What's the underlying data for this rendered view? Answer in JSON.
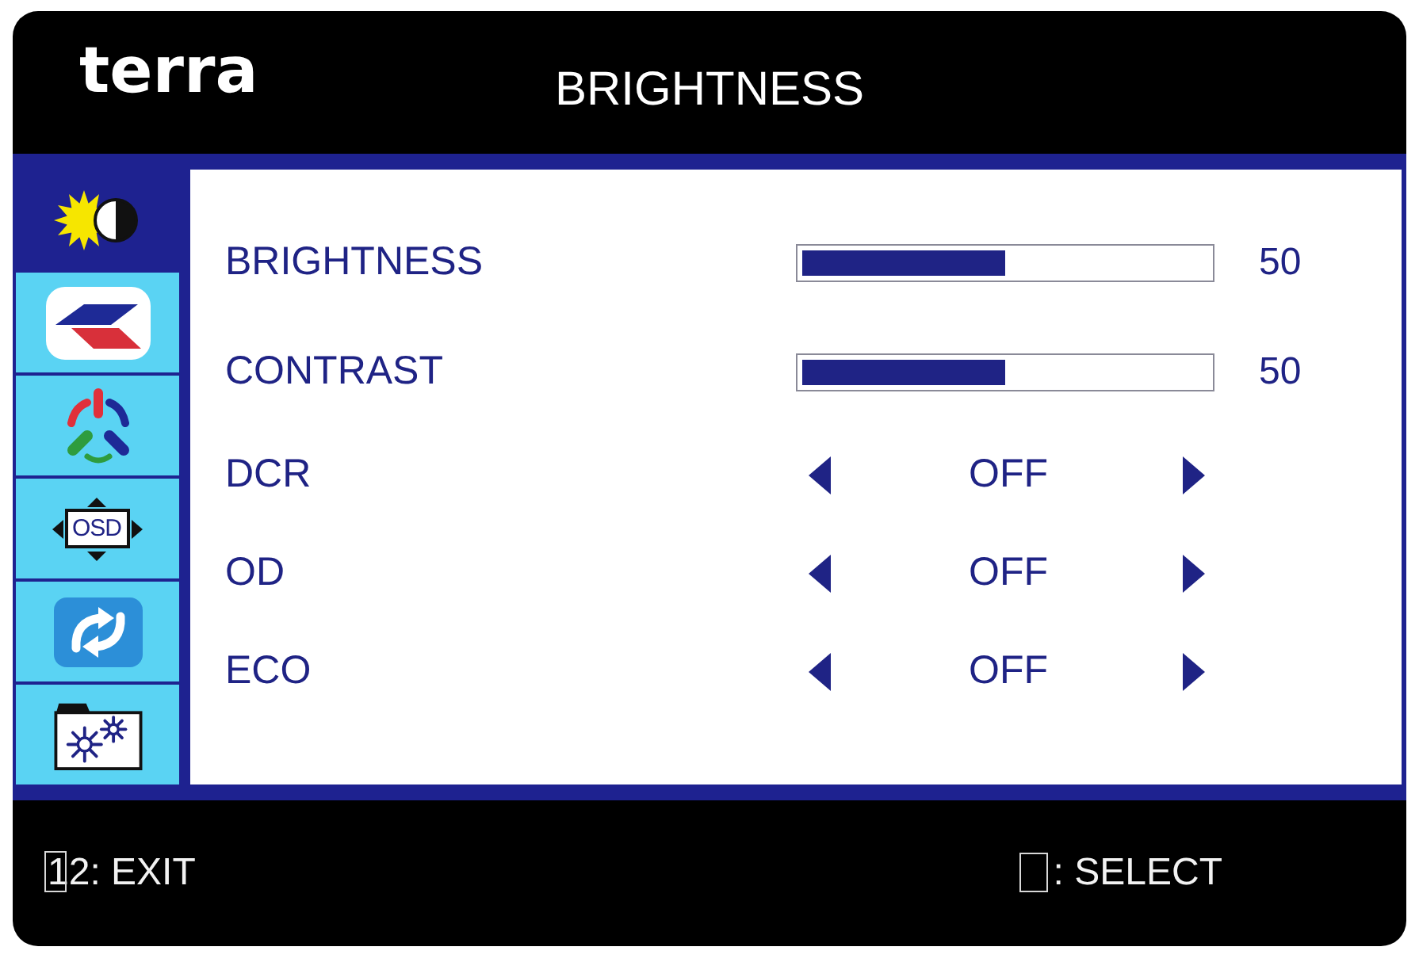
{
  "header": {
    "logo": "terra",
    "title": "BRIGHTNESS"
  },
  "sidebar": {
    "items": [
      {
        "kind": "brightness",
        "selected": true
      },
      {
        "kind": "image",
        "selected": false
      },
      {
        "kind": "color",
        "selected": false
      },
      {
        "kind": "osd",
        "label": "OSD",
        "selected": false
      },
      {
        "kind": "reset",
        "selected": false
      },
      {
        "kind": "setup",
        "selected": false
      }
    ]
  },
  "settings": [
    {
      "kind": "slider",
      "label": "BRIGHTNESS",
      "level": 0.5,
      "reading": "50"
    },
    {
      "kind": "slider",
      "label": "CONTRAST",
      "level": 0.5,
      "reading": "50"
    },
    {
      "kind": "option",
      "label": "DCR",
      "value": "OFF"
    },
    {
      "kind": "option",
      "label": "OD",
      "value": "OFF"
    },
    {
      "kind": "option",
      "label": "ECO",
      "value": "OFF"
    }
  ],
  "footer": {
    "exit_hint": "12: EXIT",
    "select_hint": ": SELECT"
  }
}
